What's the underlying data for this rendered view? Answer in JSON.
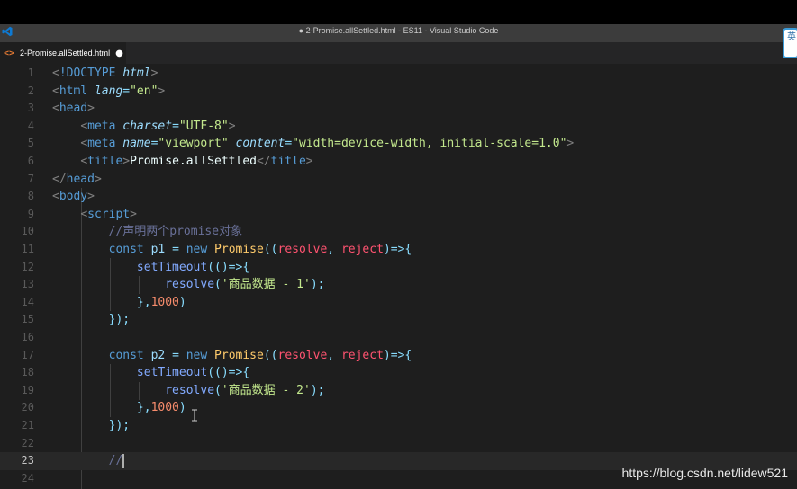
{
  "window": {
    "title": "● 2-Promise.allSettled.html - ES11 - Visual Studio Code"
  },
  "tab": {
    "icon": "<>",
    "label": "2-Promise.allSettled.html",
    "dirty_marker": "●"
  },
  "ime": {
    "label": "英"
  },
  "editor": {
    "current_line": 23,
    "lines": [
      {
        "n": "1",
        "tokens": [
          [
            "br",
            "<"
          ],
          [
            "tag",
            "!DOCTYPE"
          ],
          [
            "br",
            " "
          ],
          [
            "attr",
            "html"
          ],
          [
            "br",
            ">"
          ]
        ]
      },
      {
        "n": "2",
        "tokens": [
          [
            "br",
            "<"
          ],
          [
            "tag",
            "html"
          ],
          [
            "txt",
            " "
          ],
          [
            "attr",
            "lang"
          ],
          [
            "p",
            "="
          ],
          [
            "str2",
            "\"en\""
          ],
          [
            "br",
            ">"
          ]
        ]
      },
      {
        "n": "3",
        "tokens": [
          [
            "br",
            "<"
          ],
          [
            "tag",
            "head"
          ],
          [
            "br",
            ">"
          ]
        ]
      },
      {
        "n": "4",
        "tokens": [
          [
            "txt",
            "    "
          ],
          [
            "br",
            "<"
          ],
          [
            "tag",
            "meta"
          ],
          [
            "txt",
            " "
          ],
          [
            "attr",
            "charset"
          ],
          [
            "p",
            "="
          ],
          [
            "str2",
            "\"UTF-8\""
          ],
          [
            "br",
            ">"
          ]
        ]
      },
      {
        "n": "5",
        "tokens": [
          [
            "txt",
            "    "
          ],
          [
            "br",
            "<"
          ],
          [
            "tag",
            "meta"
          ],
          [
            "txt",
            " "
          ],
          [
            "attr",
            "name"
          ],
          [
            "p",
            "="
          ],
          [
            "str2",
            "\"viewport\""
          ],
          [
            "txt",
            " "
          ],
          [
            "attr",
            "content"
          ],
          [
            "p",
            "="
          ],
          [
            "str2",
            "\"width=device-width, initial-scale=1.0\""
          ],
          [
            "br",
            ">"
          ]
        ]
      },
      {
        "n": "6",
        "tokens": [
          [
            "txt",
            "    "
          ],
          [
            "br",
            "<"
          ],
          [
            "tag",
            "title"
          ],
          [
            "br",
            ">"
          ],
          [
            "txt",
            "Promise.allSettled"
          ],
          [
            "br",
            "</"
          ],
          [
            "tag",
            "title"
          ],
          [
            "br",
            ">"
          ]
        ]
      },
      {
        "n": "7",
        "tokens": [
          [
            "br",
            "</"
          ],
          [
            "tag",
            "head"
          ],
          [
            "br",
            ">"
          ]
        ]
      },
      {
        "n": "8",
        "tokens": [
          [
            "br",
            "<"
          ],
          [
            "tag",
            "body"
          ],
          [
            "br",
            ">"
          ]
        ]
      },
      {
        "n": "9",
        "tokens": [
          [
            "txt",
            "    "
          ],
          [
            "br",
            "<"
          ],
          [
            "tag",
            "script"
          ],
          [
            "br",
            ">"
          ]
        ]
      },
      {
        "n": "10",
        "tokens": [
          [
            "txt",
            "        "
          ],
          [
            "com",
            "//声明两个promise对象"
          ]
        ]
      },
      {
        "n": "11",
        "tokens": [
          [
            "txt",
            "        "
          ],
          [
            "kw",
            "const"
          ],
          [
            "txt",
            " "
          ],
          [
            "var",
            "p1"
          ],
          [
            "txt",
            " "
          ],
          [
            "p",
            "="
          ],
          [
            "txt",
            " "
          ],
          [
            "kw",
            "new"
          ],
          [
            "txt",
            " "
          ],
          [
            "cls",
            "Promise"
          ],
          [
            "p",
            "(("
          ],
          [
            "par",
            "resolve"
          ],
          [
            "p",
            ", "
          ],
          [
            "par",
            "reject"
          ],
          [
            "p",
            ")=>{"
          ]
        ]
      },
      {
        "n": "12",
        "tokens": [
          [
            "txt",
            "            "
          ],
          [
            "fn",
            "setTimeout"
          ],
          [
            "p",
            "(()=>{"
          ]
        ]
      },
      {
        "n": "13",
        "tokens": [
          [
            "txt",
            "                "
          ],
          [
            "fn",
            "resolve"
          ],
          [
            "p",
            "("
          ],
          [
            "str2",
            "'商品数据 - 1'"
          ],
          [
            "p",
            ");"
          ]
        ]
      },
      {
        "n": "14",
        "tokens": [
          [
            "txt",
            "            "
          ],
          [
            "p",
            "},"
          ],
          [
            "num",
            "1000"
          ],
          [
            "p",
            ")"
          ]
        ]
      },
      {
        "n": "15",
        "tokens": [
          [
            "txt",
            "        "
          ],
          [
            "p",
            "});"
          ]
        ]
      },
      {
        "n": "16",
        "tokens": []
      },
      {
        "n": "17",
        "tokens": [
          [
            "txt",
            "        "
          ],
          [
            "kw",
            "const"
          ],
          [
            "txt",
            " "
          ],
          [
            "var",
            "p2"
          ],
          [
            "txt",
            " "
          ],
          [
            "p",
            "="
          ],
          [
            "txt",
            " "
          ],
          [
            "kw",
            "new"
          ],
          [
            "txt",
            " "
          ],
          [
            "cls",
            "Promise"
          ],
          [
            "p",
            "(("
          ],
          [
            "par",
            "resolve"
          ],
          [
            "p",
            ", "
          ],
          [
            "par",
            "reject"
          ],
          [
            "p",
            ")=>{"
          ]
        ]
      },
      {
        "n": "18",
        "tokens": [
          [
            "txt",
            "            "
          ],
          [
            "fn",
            "setTimeout"
          ],
          [
            "p",
            "(()=>{"
          ]
        ]
      },
      {
        "n": "19",
        "tokens": [
          [
            "txt",
            "                "
          ],
          [
            "fn",
            "resolve"
          ],
          [
            "p",
            "("
          ],
          [
            "str2",
            "'商品数据 - 2'"
          ],
          [
            "p",
            ");"
          ]
        ]
      },
      {
        "n": "20",
        "tokens": [
          [
            "txt",
            "            "
          ],
          [
            "p",
            "},"
          ],
          [
            "num",
            "1000"
          ],
          [
            "p",
            ")"
          ]
        ]
      },
      {
        "n": "21",
        "tokens": [
          [
            "txt",
            "        "
          ],
          [
            "p",
            "});"
          ]
        ]
      },
      {
        "n": "22",
        "tokens": []
      },
      {
        "n": "23",
        "tokens": [
          [
            "txt",
            "        "
          ],
          [
            "com",
            "//"
          ]
        ]
      },
      {
        "n": "24",
        "tokens": []
      }
    ]
  },
  "watermark": {
    "text": "https://blog.csdn.net/lidew521"
  },
  "colors": {
    "editor_bg": "#1e1e1e",
    "titlebar_bg": "#3c3c3c",
    "tab_icon": "#e37933",
    "accent": "#3a9bd8"
  }
}
